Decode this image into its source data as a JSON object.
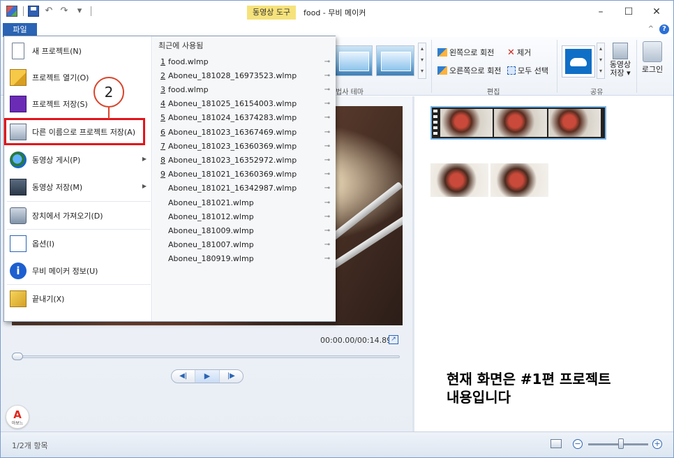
{
  "window": {
    "context_tab": "동영상 도구",
    "title": "food - 무비 메이커",
    "controls": [
      "–",
      "☐",
      "✕"
    ]
  },
  "ribbon": {
    "file_tab": "파일",
    "collapse": "^",
    "help": "?",
    "group_theme_label": "법사 테마",
    "group_edit_label": "편집",
    "group_share_label": "공유",
    "rotate_left": "왼쪽으로 회전",
    "rotate_right": "오른쪽으로 회전",
    "remove": "제거",
    "select_all": "모두 선택",
    "save_video_line1": "동영상",
    "save_video_line2": "저장 ▾",
    "sign_in": "로그인"
  },
  "file_menu": {
    "items": [
      {
        "label": "새 프로젝트(N)",
        "icon": "new-project-icon"
      },
      {
        "label": "프로젝트 열기(O)",
        "icon": "open-project-icon"
      },
      {
        "label": "프로젝트 저장(S)",
        "icon": "save-project-icon"
      },
      {
        "label": "다른 이름으로 프로젝트 저장(A)",
        "icon": "save-as-icon"
      },
      {
        "label": "동영상 게시(P)",
        "icon": "publish-video-icon"
      },
      {
        "label": "동영상 저장(M)",
        "icon": "save-video-icon"
      },
      {
        "label": "장치에서 가져오기(D)",
        "icon": "import-device-icon"
      },
      {
        "label": "옵션(I)",
        "icon": "options-icon"
      },
      {
        "label": "무비 메이커 정보(U)",
        "icon": "about-icon"
      },
      {
        "label": "끝내기(X)",
        "icon": "exit-icon"
      }
    ],
    "callout_number": "2",
    "recent_title": "최근에 사용됨",
    "recent": [
      {
        "num": "1",
        "name": "food.wlmp"
      },
      {
        "num": "2",
        "name": "Aboneu_181028_16973523.wlmp"
      },
      {
        "num": "3",
        "name": "food.wlmp"
      },
      {
        "num": "4",
        "name": "Aboneu_181025_16154003.wlmp"
      },
      {
        "num": "5",
        "name": "Aboneu_181024_16374283.wlmp"
      },
      {
        "num": "6",
        "name": "Aboneu_181023_16367469.wlmp"
      },
      {
        "num": "7",
        "name": "Aboneu_181023_16360369.wlmp"
      },
      {
        "num": "8",
        "name": "Aboneu_181023_16352972.wlmp"
      },
      {
        "num": "9",
        "name": "Aboneu_181021_16360369.wlmp"
      },
      {
        "num": "",
        "name": "Aboneu_181021_16342987.wlmp"
      },
      {
        "num": "",
        "name": "Aboneu_181021.wlmp"
      },
      {
        "num": "",
        "name": "Aboneu_181012.wlmp"
      },
      {
        "num": "",
        "name": "Aboneu_181009.wlmp"
      },
      {
        "num": "",
        "name": "Aboneu_181007.wlmp"
      },
      {
        "num": "",
        "name": "Aboneu_180919.wlmp"
      }
    ],
    "pin_glyph": "⊸"
  },
  "player": {
    "timecode": "00:00.00/00:14.89",
    "prev_frame": "◀|",
    "play": "▶",
    "next_frame": "|▶"
  },
  "storyboard": {
    "notice_line1": "현재 화면은 #1편 프로젝트",
    "notice_line2": "내용입니다"
  },
  "logo": {
    "mark": "A",
    "text": "아보느"
  },
  "statusbar": {
    "item_count": "1/2개 항목",
    "zoom_out": "−",
    "zoom_in": "+",
    "zoom_level": 0.55
  },
  "colors": {
    "accent": "#2b64b4",
    "highlight": "#e4131b",
    "callout": "#d9442b"
  }
}
